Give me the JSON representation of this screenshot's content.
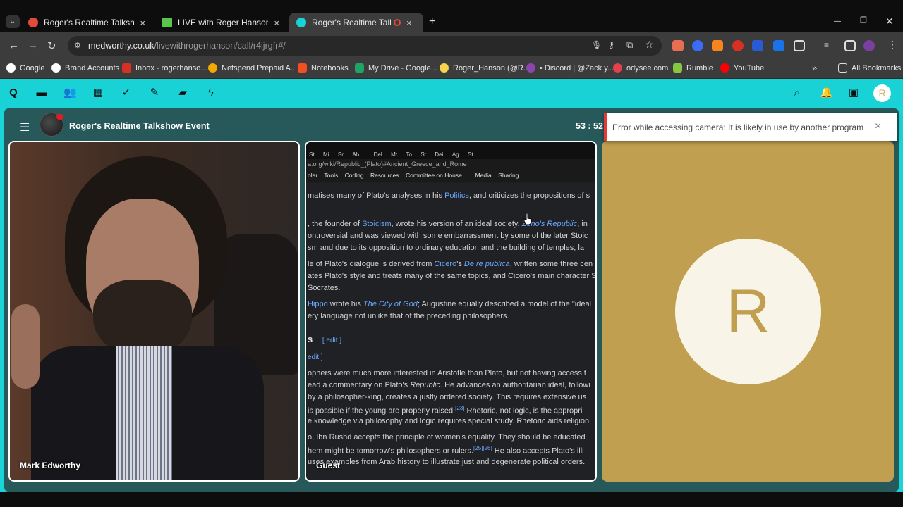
{
  "browser": {
    "tabs": [
      {
        "title": "Roger's Realtime Talkshow Eve",
        "active": false,
        "fav_color": "#e24a3b"
      },
      {
        "title": "LIVE with Roger Hanson: Roger",
        "active": false,
        "fav_color": "#57c64b"
      },
      {
        "title": "Roger's Realtime Talkshow E",
        "active": true,
        "fav_color": "#19d2d6"
      }
    ],
    "new_tab": "+",
    "tab_close": "×",
    "window": {
      "minimize": "—",
      "maximize": "❐",
      "close": "✕"
    },
    "url_host": "medworthy.co.uk",
    "url_path": "/livewithrogerhanson/call/r4ijrgfr#/",
    "bookmarks": [
      {
        "label": "Google",
        "color": "#ffffff"
      },
      {
        "label": "Brand Accounts",
        "color": "#ffffff"
      },
      {
        "label": "Inbox - rogerhanso...",
        "color": "#d93025"
      },
      {
        "label": "Netspend Prepaid A...",
        "color": "#f2a900"
      },
      {
        "label": "Notebooks",
        "color": "#f25022"
      },
      {
        "label": "My Drive - Google...",
        "color": "#1fa463"
      },
      {
        "label": "Roger_Hanson (@R...",
        "color": "#f7d44c"
      },
      {
        "label": "• Discord | @Zack y...",
        "color": "#8e44ad"
      },
      {
        "label": "odysee.com",
        "color": "#e5414b"
      },
      {
        "label": "Rumble",
        "color": "#85c742"
      },
      {
        "label": "YouTube",
        "color": "#ff0000"
      }
    ],
    "all_bookmarks": "All Bookmarks",
    "bookmarks_overflow": "»"
  },
  "app": {
    "avatar_letter": "R",
    "nav_icons": [
      "home-icon",
      "folder-icon",
      "people-icon",
      "calendar-icon",
      "check-icon",
      "pen-icon",
      "briefcase-icon",
      "bolt-icon"
    ]
  },
  "call": {
    "title": "Roger's Realtime Talkshow Event",
    "timer": "53 : 52",
    "participants": {
      "tile1_name": "Mark Edworthy",
      "tile2_name": "Guest",
      "avatar_letter": "R"
    },
    "toast": {
      "message": "Error while accessing camera: It is likely in use by another program",
      "close": "×"
    }
  },
  "screenshare": {
    "tab_fragments": [
      "St",
      "Mi",
      "Sr",
      "Ah",
      "",
      "Del",
      "Mt",
      "To",
      "St",
      "Dei",
      "Ag",
      "St"
    ],
    "url": "a.org/wiki/Republic_(Plato)#Ancient_Greece_and_Rome",
    "bookmarks": [
      "olar",
      "Tools",
      "Coding",
      "Resources",
      "Committee on House ...",
      "Media",
      "Sharing"
    ],
    "lines": {
      "l1a": "matises many of Plato's analyses in his ",
      "l1b": "Politics",
      "l1c": ", and criticizes the propositions of s",
      "l2a": ", the founder of ",
      "l2b": "Stoicism",
      "l2c": ", wrote his version of an ideal society, ",
      "l2d": "Zeno's Republic",
      "l2e": ", in",
      "l3": "ontroversial and was viewed with some embarrassment by some of the later Stoic",
      "l4": "sm and due to its opposition to ordinary education and the building of temples, la",
      "l5a": "le of Plato's dialogue is derived from ",
      "l5b": "Cicero",
      "l5c": "'s ",
      "l5d": "De re publica",
      "l5e": ", written some three cen",
      "l6": "ates Plato's style and treats many of the same topics, and Cicero's main character S",
      "l7": "Socrates.",
      "l8a": "Hippo",
      "l8b": " wrote his ",
      "l8c": "The City of God",
      "l8d": "; Augustine equally described a model of the \"ideal",
      "l9": "ery language not unlike that of the preceding philosophers.",
      "h1": "s",
      "h1edit": "[ edit ]",
      "h2edit": "edit ]",
      "l10": "ophers were much more interested in Aristotle than Plato, but not having access t",
      "l11a": "ead a commentary on Plato's ",
      "l11b": "Republic",
      "l11c": ". He advances an authoritarian ideal, followi",
      "l12": " by a philosopher-king, creates a justly ordered society. This requires extensive us",
      "l13a": "is possible if the young are properly raised.",
      "l13b": "[23]",
      "l13c": " Rhetoric, not logic, is the appropri",
      "l14": "e knowledge via philosophy and logic requires special study. Rhetoric aids religion",
      "l15": "o, Ibn Rushd accepts the principle of women's equality. They should be educated",
      "l16a": "hem might be tomorrow's philosophers or rulers.",
      "l16b": "[25][26]",
      "l16c": " He also accepts Plato's illi",
      "l17": "uses examples from Arab history to illustrate just and degenerate political orders."
    }
  }
}
